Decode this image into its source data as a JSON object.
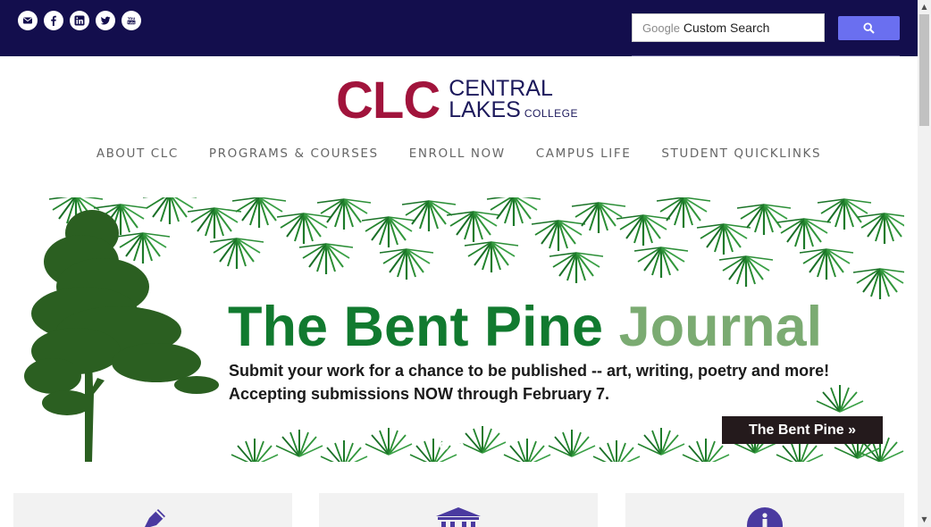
{
  "social": {
    "icons": [
      "email-icon",
      "facebook-icon",
      "linkedin-icon",
      "twitter-icon",
      "youtube-icon"
    ],
    "email_glyph": "✉",
    "facebook_glyph": "f",
    "linkedin_glyph": "in",
    "youtube_glyph": "You"
  },
  "search": {
    "google_label": "Google",
    "placeholder": "Custom Search"
  },
  "logo": {
    "mark": "CLC",
    "line1": "CENTRAL",
    "line2": "LAKES",
    "line3": "COLLEGE"
  },
  "nav": {
    "items": [
      "ABOUT CLC",
      "PROGRAMS & COURSES",
      "ENROLL NOW",
      "CAMPUS LIFE",
      "STUDENT QUICKLINKS"
    ]
  },
  "hero": {
    "title_main": "The Bent Pine",
    "title_accent": "Journal",
    "line1": "Submit your work for a chance to be published -- art, writing, poetry and more!",
    "line2": "Accepting submissions NOW through February 7.",
    "cta": "The Bent Pine »",
    "slides": 2
  },
  "colors": {
    "topbar": "#130e4d",
    "brand_red": "#a1143c",
    "brand_navy": "#1d1a5c",
    "search_button": "#6a6ff0",
    "icon_purple": "#4a3aa0"
  },
  "cards": [
    "pencil-icon",
    "institution-icon",
    "info-icon"
  ]
}
